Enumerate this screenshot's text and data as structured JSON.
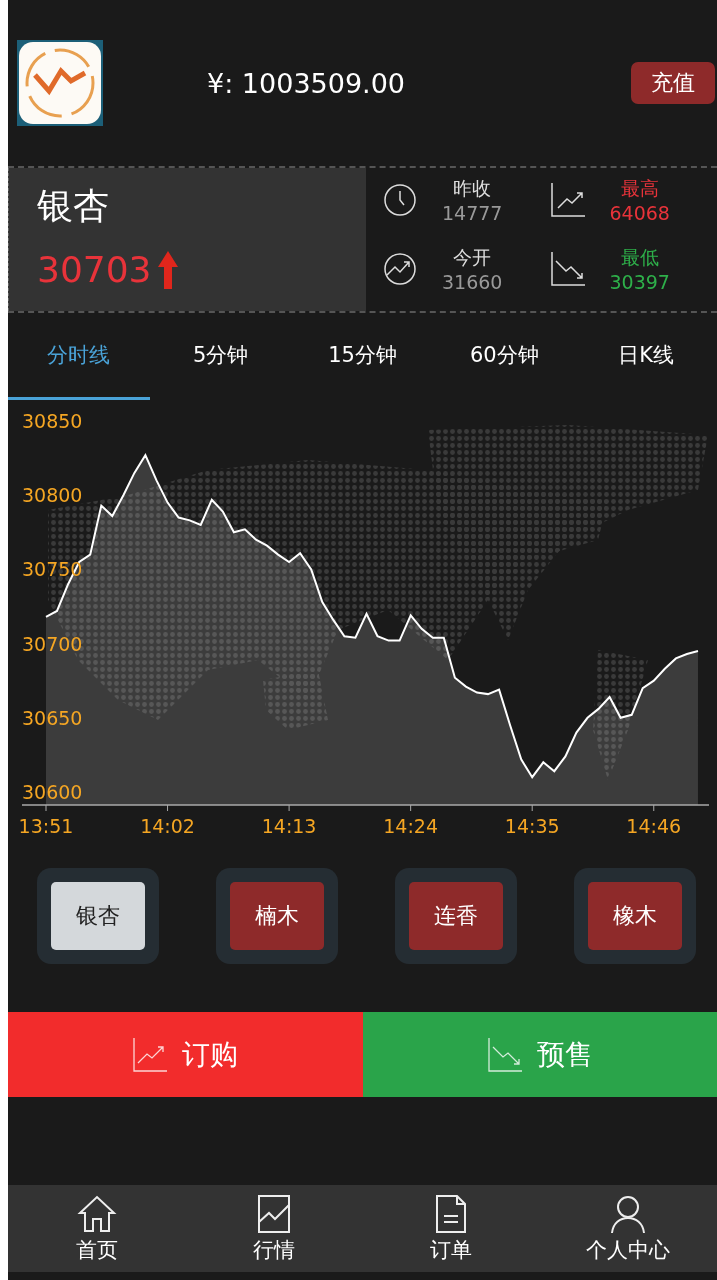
{
  "header": {
    "balance": "¥: 1003509.00",
    "recharge_button": "充值"
  },
  "quote": {
    "name": "银杏",
    "price": "30703",
    "stats": [
      {
        "kind": "clock",
        "label": "昨收",
        "value": "14777",
        "color": "#dddddd"
      },
      {
        "kind": "rise",
        "label": "最高",
        "value": "64068",
        "color": "#e8333a"
      },
      {
        "kind": "trend",
        "label": "今开",
        "value": "31660",
        "color": "#dddddd"
      },
      {
        "kind": "fall",
        "label": "最低",
        "value": "30397",
        "color": "#2eb04a"
      }
    ]
  },
  "tabs": [
    {
      "label": "分时线",
      "selected": true
    },
    {
      "label": "5分钟",
      "selected": false
    },
    {
      "label": "15分钟",
      "selected": false
    },
    {
      "label": "60分钟",
      "selected": false
    },
    {
      "label": "日K线",
      "selected": false
    }
  ],
  "chart": {
    "chart_data": {
      "type": "area",
      "categories": [
        "13:51",
        null,
        null,
        null,
        null,
        null,
        null,
        null,
        null,
        null,
        null,
        "14:02",
        null,
        null,
        null,
        null,
        null,
        null,
        null,
        null,
        null,
        null,
        "14:13",
        null,
        null,
        null,
        null,
        null,
        null,
        null,
        null,
        null,
        null,
        "14:24",
        null,
        null,
        null,
        null,
        null,
        null,
        null,
        null,
        null,
        null,
        "14:35",
        null,
        null,
        null,
        null,
        null,
        null,
        null,
        null,
        null,
        null,
        "14:46",
        null,
        null,
        null,
        null
      ],
      "series": [
        {
          "color": "#ffffff",
          "values": [
            30718,
            30722,
            30740,
            30755,
            30760,
            30793,
            30786,
            30800,
            30815,
            30827,
            30810,
            30795,
            30785,
            30783,
            30780,
            30797,
            30789,
            30775,
            30777,
            30770,
            30766,
            30760,
            30755,
            30761,
            30750,
            30728,
            30716,
            30705,
            30704,
            30720,
            30705,
            30702,
            30702,
            30719,
            30710,
            30704,
            30704,
            30677,
            30671,
            30667,
            30666,
            30669,
            30645,
            30622,
            30610,
            30620,
            30614,
            30624,
            30640,
            30650,
            30656,
            30664,
            30650,
            30652,
            30670,
            30675,
            30683,
            30690,
            30693,
            30695
          ]
        }
      ],
      "ylim": [
        30600,
        30850
      ],
      "yticks": [
        30600,
        30650,
        30700,
        30750,
        30800,
        30850
      ]
    }
  },
  "products": [
    {
      "label": "银杏",
      "selected": true
    },
    {
      "label": "楠木",
      "selected": false
    },
    {
      "label": "连香",
      "selected": false
    },
    {
      "label": "橡木",
      "selected": false
    }
  ],
  "actions": [
    {
      "kind": "buy",
      "label": "订购"
    },
    {
      "kind": "sell",
      "label": "预售"
    }
  ],
  "nav": [
    {
      "kind": "home",
      "label": "首页"
    },
    {
      "kind": "chart",
      "label": "行情"
    },
    {
      "kind": "doc",
      "label": "订单"
    },
    {
      "kind": "user",
      "label": "个人中心"
    }
  ]
}
